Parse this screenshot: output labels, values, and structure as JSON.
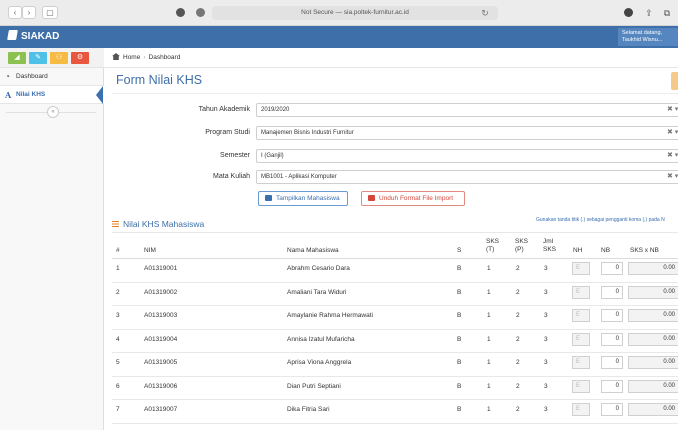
{
  "browser": {
    "url": "Not Secure — sia.poltek-furnitur.ac.id",
    "back_icon": "chevron-left-icon",
    "forward_icon": "chevron-right-icon"
  },
  "app": {
    "brand": "SIAKAD",
    "user_greeting": "Selamat datang,",
    "user_name": "Taukhid Wisnu..."
  },
  "sidebar": {
    "shortcuts": [
      {
        "icon": "chart-icon",
        "color": "#8cc152"
      },
      {
        "icon": "pencil-icon",
        "color": "#4fc1e9"
      },
      {
        "icon": "users-icon",
        "color": "#f6bb42"
      },
      {
        "icon": "gear-icon",
        "color": "#e9573f"
      }
    ],
    "items": [
      {
        "label": "Dashboard",
        "icon": "dashboard-icon",
        "active": false
      },
      {
        "label": "Nilai KHS",
        "icon": "letter-a-icon",
        "active": true
      }
    ]
  },
  "breadcrumb": {
    "home": "Home",
    "current": "Dashboard"
  },
  "form": {
    "title": "Form Nilai KHS",
    "fields": [
      {
        "label": "Tahun Akademik",
        "value": "2019/2020"
      },
      {
        "label": "Program Studi",
        "value": "Manajemen Bisnis Industri Furnitur"
      },
      {
        "label": "Semester",
        "value": "I (Ganjil)"
      },
      {
        "label": "Mata Kuliah",
        "value": "MB1001 - Aplikasi Komputer"
      }
    ],
    "clear_symbol": "✖ ▾",
    "btn_tampil": "Tampilkan Mahasiswa",
    "btn_unduh": "Unduh Format File Import"
  },
  "table": {
    "title": "Nilai KHS Mahasiswa",
    "hint": "Gunakan tanda titik (.) sebagai pengganti koma (,) pada N",
    "headers": {
      "no": "#",
      "nim": "NIM",
      "nama": "Nama Mahasiswa",
      "s": "S",
      "sks_t_1": "SKS",
      "sks_t_2": "(T)",
      "sks_p_1": "SKS",
      "sks_p_2": "(P)",
      "jml_1": "Jml",
      "jml_2": "SKS",
      "nh": "NH",
      "nb": "NB",
      "sksxnb": "SKS x NB"
    },
    "rows": [
      {
        "no": "1",
        "nim": "A01319001",
        "nama": "Abrahm Cesario Dara",
        "s": "B",
        "t": "1",
        "p": "2",
        "jml": "3",
        "nh": "E",
        "nb": "0",
        "sksxnb": "0.00"
      },
      {
        "no": "2",
        "nim": "A01319002",
        "nama": "Amaliani Tara Widuri",
        "s": "B",
        "t": "1",
        "p": "2",
        "jml": "3",
        "nh": "E",
        "nb": "0",
        "sksxnb": "0.00"
      },
      {
        "no": "3",
        "nim": "A01319003",
        "nama": "Amaylanie Rahma Hermawati",
        "s": "B",
        "t": "1",
        "p": "2",
        "jml": "3",
        "nh": "E",
        "nb": "0",
        "sksxnb": "0.00"
      },
      {
        "no": "4",
        "nim": "A01319004",
        "nama": "Annisa Izatul Mufaricha",
        "s": "B",
        "t": "1",
        "p": "2",
        "jml": "3",
        "nh": "E",
        "nb": "0",
        "sksxnb": "0.00"
      },
      {
        "no": "5",
        "nim": "A01319005",
        "nama": "Aprisa Viona Anggrela",
        "s": "B",
        "t": "1",
        "p": "2",
        "jml": "3",
        "nh": "E",
        "nb": "0",
        "sksxnb": "0.00"
      },
      {
        "no": "6",
        "nim": "A01319006",
        "nama": "Dian Putri Septiani",
        "s": "B",
        "t": "1",
        "p": "2",
        "jml": "3",
        "nh": "E",
        "nb": "0",
        "sksxnb": "0.00"
      },
      {
        "no": "7",
        "nim": "A01319007",
        "nama": "Dika Fitria Sari",
        "s": "B",
        "t": "1",
        "p": "2",
        "jml": "3",
        "nh": "E",
        "nb": "0",
        "sksxnb": "0.00"
      }
    ]
  }
}
